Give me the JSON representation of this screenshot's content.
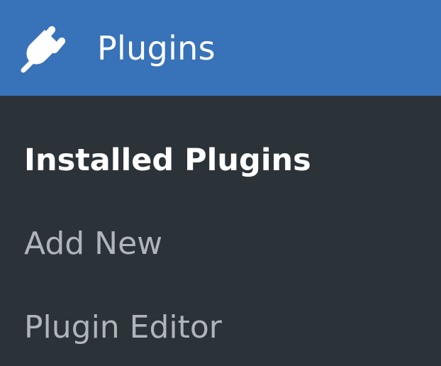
{
  "menu": {
    "title": "Plugins",
    "icon": "plug-icon",
    "colors": {
      "header_bg": "#3872b8",
      "menu_bg": "#2c3338",
      "current_text": "#ffffff",
      "item_text": "#b0b5ba"
    },
    "items": [
      {
        "label": "Installed Plugins",
        "current": true
      },
      {
        "label": "Add New",
        "current": false
      },
      {
        "label": "Plugin Editor",
        "current": false
      }
    ]
  }
}
